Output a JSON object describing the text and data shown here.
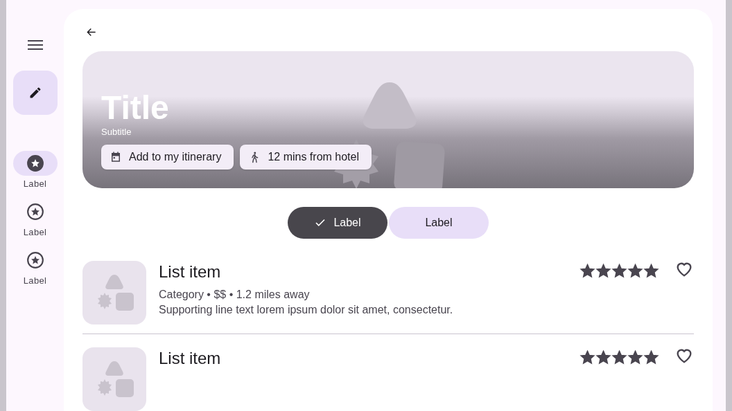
{
  "rail": {
    "items": [
      {
        "label": "Label",
        "selected": true
      },
      {
        "label": "Label",
        "selected": false
      },
      {
        "label": "Label",
        "selected": false
      }
    ]
  },
  "hero": {
    "title": "Title",
    "subtitle": "Subtitle",
    "chips": [
      {
        "kind": "calendar",
        "label": "Add to my itinerary"
      },
      {
        "kind": "walk",
        "label": "12 mins from hotel"
      }
    ]
  },
  "segments": [
    {
      "label": "Label",
      "selected": true
    },
    {
      "label": "Label",
      "selected": false
    }
  ],
  "list": [
    {
      "title": "List item",
      "meta": "Category • $$ • 1.2 miles away",
      "supporting": "Supporting line text lorem ipsum dolor sit amet, consectetur.",
      "stars": 5,
      "favorite": false
    },
    {
      "title": "List item",
      "stars": 5,
      "favorite": false
    }
  ]
}
